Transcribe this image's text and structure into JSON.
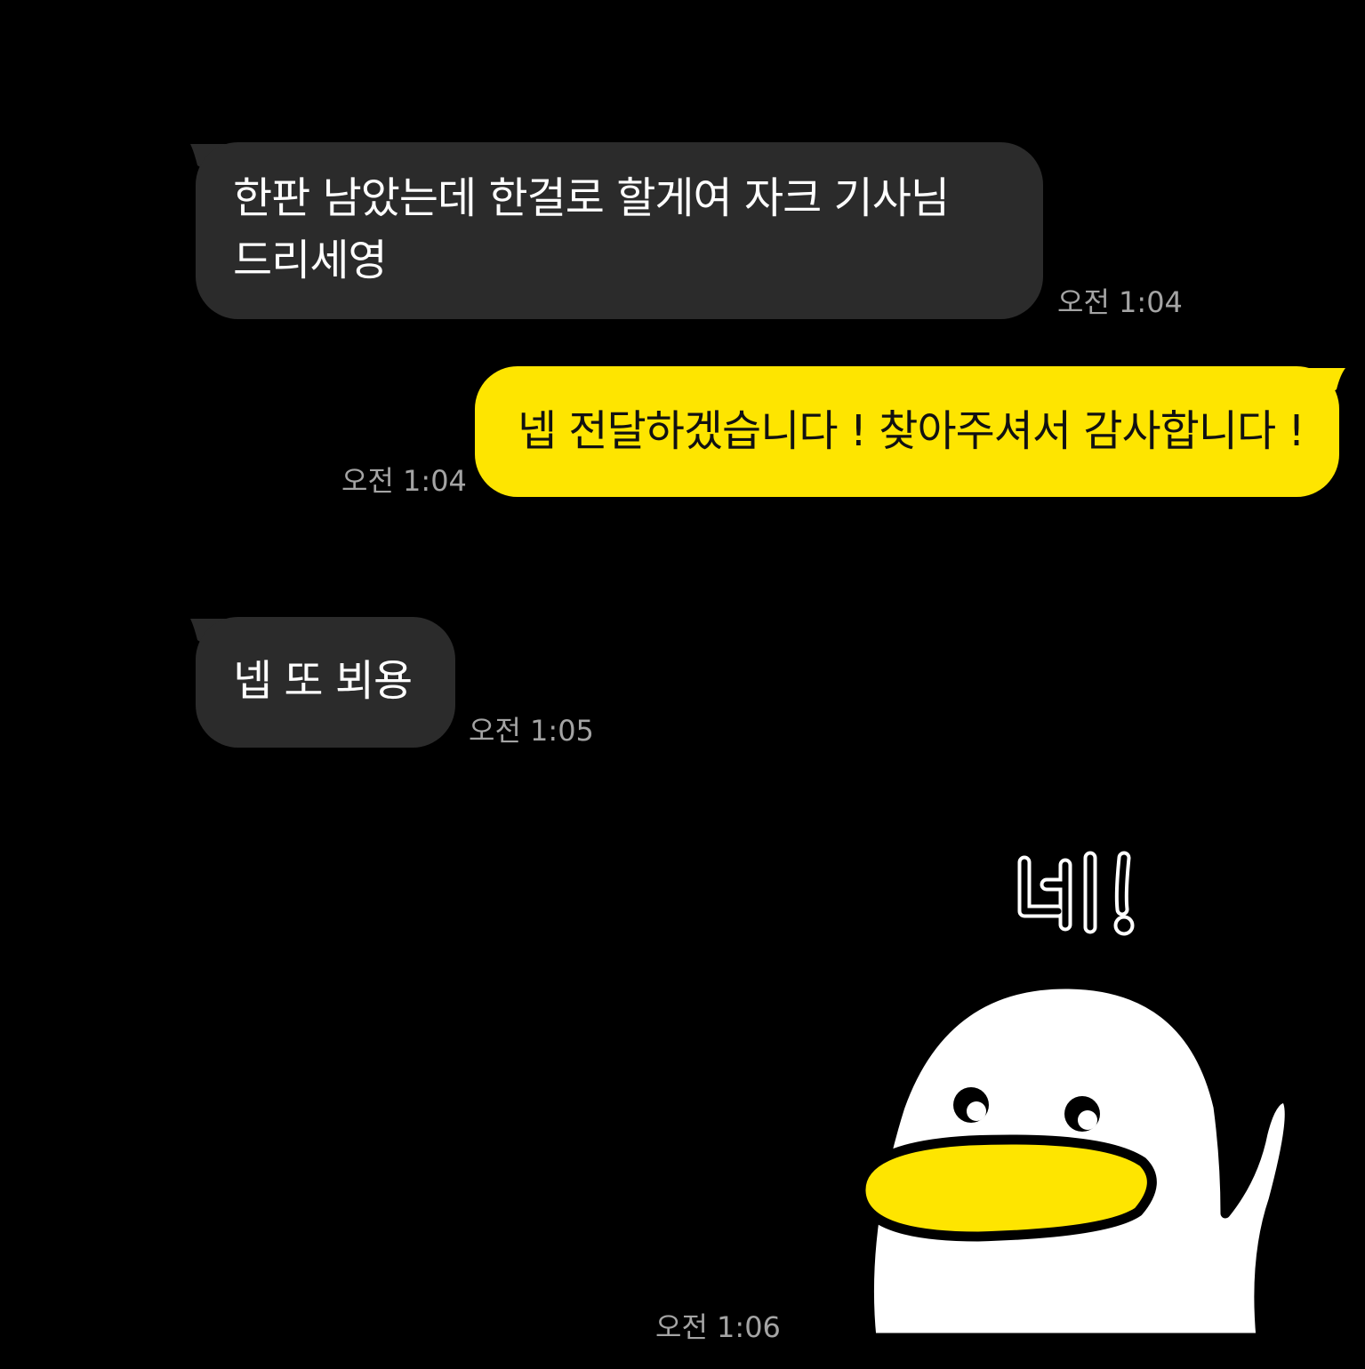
{
  "chat": {
    "messages": [
      {
        "direction": "incoming",
        "text": "한판 남았는데 한걸로 할게여 자크 기사님\n드리세영",
        "time": "오전 1:04"
      },
      {
        "direction": "outgoing",
        "text": "넵 전달하겠습니다 ! 찾아주셔서 감사합니다 !",
        "time": "오전 1:04"
      },
      {
        "direction": "incoming",
        "text": "넵 또 뵈용",
        "time": "오전 1:05"
      },
      {
        "direction": "outgoing",
        "type": "sticker",
        "sticker_icon": "yellow-beak-duck-waving-icon",
        "sticker_text": "네!",
        "time": "오전 1:06"
      }
    ]
  },
  "colors": {
    "background": "#000000",
    "incoming_bubble": "#2b2b2b",
    "outgoing_bubble": "#fee500",
    "timestamp": "#a4a4a4"
  }
}
